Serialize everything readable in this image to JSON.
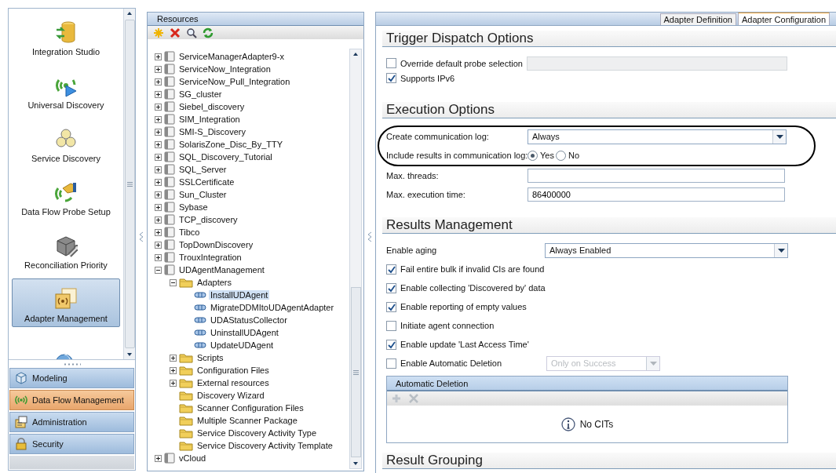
{
  "nav": {
    "items": [
      {
        "kind": "integration",
        "label": "Integration Studio",
        "selected": false
      },
      {
        "kind": "discovery",
        "label": "Universal Discovery",
        "selected": false
      },
      {
        "kind": "service",
        "label": "Service Discovery",
        "selected": false
      },
      {
        "kind": "probe",
        "label": "Data Flow Probe Setup",
        "selected": false
      },
      {
        "kind": "reconciliation",
        "label": "Reconciliation Priority",
        "selected": false
      },
      {
        "kind": "adapter",
        "label": "Adapter Management",
        "selected": true
      },
      {
        "kind": "globe",
        "selected": false
      }
    ],
    "modules": [
      {
        "kind": "modeling",
        "label": "Modeling",
        "selected": false
      },
      {
        "kind": "dataflow",
        "label": "Data Flow Management",
        "selected": true
      },
      {
        "kind": "admin",
        "label": "Administration",
        "selected": false
      },
      {
        "kind": "security",
        "label": "Security",
        "selected": false
      }
    ]
  },
  "resources": {
    "title": "Resources",
    "toolbar": [
      {
        "kind": "new"
      },
      {
        "kind": "delete"
      },
      {
        "kind": "find"
      },
      {
        "kind": "refresh"
      }
    ],
    "tree": [
      {
        "kind": "package",
        "label": "ServiceManagerAdapter9-x",
        "expanded": false,
        "selected": false
      },
      {
        "kind": "package",
        "label": "ServiceNow_Integration",
        "expanded": false,
        "selected": false
      },
      {
        "kind": "package",
        "label": "ServiceNow_Pull_Integration",
        "expanded": false,
        "selected": false
      },
      {
        "kind": "package",
        "label": "SG_cluster",
        "expanded": false,
        "selected": false
      },
      {
        "kind": "package",
        "label": "Siebel_discovery",
        "expanded": false,
        "selected": false
      },
      {
        "kind": "package",
        "label": "SIM_Integration",
        "expanded": false,
        "selected": false
      },
      {
        "kind": "package",
        "label": "SMI-S_Discovery",
        "expanded": false,
        "selected": false
      },
      {
        "kind": "package",
        "label": "SolarisZone_Disc_By_TTY",
        "expanded": false,
        "selected": false
      },
      {
        "kind": "package",
        "label": "SQL_Discovery_Tutorial",
        "expanded": false,
        "selected": false
      },
      {
        "kind": "package",
        "label": "SQL_Server",
        "expanded": false,
        "selected": false
      },
      {
        "kind": "package",
        "label": "SSLCertificate",
        "expanded": false,
        "selected": false
      },
      {
        "kind": "package",
        "label": "Sun_Cluster",
        "expanded": false,
        "selected": false
      },
      {
        "kind": "package",
        "label": "Sybase",
        "expanded": false,
        "selected": false
      },
      {
        "kind": "package",
        "label": "TCP_discovery",
        "expanded": false,
        "selected": false
      },
      {
        "kind": "package",
        "label": "Tibco",
        "expanded": false,
        "selected": false
      },
      {
        "kind": "package",
        "label": "TopDownDiscovery",
        "expanded": false,
        "selected": false
      },
      {
        "kind": "package",
        "label": "TrouxIntegration",
        "expanded": false,
        "selected": false
      },
      {
        "kind": "package",
        "label": "UDAgentManagement",
        "expanded": true,
        "selected": false,
        "children": [
          {
            "kind": "folder",
            "label": "Adapters",
            "expanded": true,
            "selected": false,
            "children": [
              {
                "kind": "adapter",
                "label": "InstallUDAgent",
                "selected": true
              },
              {
                "kind": "adapter",
                "label": "MigrateDDMItoUDAgentAdapter",
                "selected": false
              },
              {
                "kind": "adapter",
                "label": "UDAStatusCollector",
                "selected": false
              },
              {
                "kind": "adapter",
                "label": "UninstallUDAgent",
                "selected": false
              },
              {
                "kind": "adapter",
                "label": "UpdateUDAgent",
                "selected": false
              }
            ]
          },
          {
            "kind": "folder",
            "label": "Scripts",
            "expanded": false,
            "selected": false
          },
          {
            "kind": "folder",
            "label": "Configuration Files",
            "expanded": false,
            "selected": false
          },
          {
            "kind": "folder",
            "label": "External resources",
            "expanded": false,
            "selected": false
          },
          {
            "kind": "folder",
            "label": "Discovery Wizard",
            "selected": false
          },
          {
            "kind": "folder",
            "label": "Scanner Configuration Files",
            "selected": false
          },
          {
            "kind": "folder",
            "label": "Multiple Scanner Package",
            "selected": false
          },
          {
            "kind": "folder",
            "label": "Service Discovery Activity Type",
            "selected": false
          },
          {
            "kind": "folder",
            "label": "Service Discovery Activity Template",
            "selected": false
          }
        ]
      },
      {
        "kind": "package",
        "label": "vCloud",
        "expanded": false,
        "selected": false
      }
    ]
  },
  "config": {
    "tabs": [
      {
        "label": "Adapter Definition",
        "selected": false
      },
      {
        "label": "Adapter Configuration",
        "selected": true
      }
    ],
    "sections": [
      {
        "title": "Trigger Dispatch Options",
        "rows": [
          {
            "kind": "checkbox-field",
            "label": "Override default probe selection",
            "checked": false,
            "disabled": true
          },
          {
            "kind": "checkbox",
            "label": "Supports IPv6",
            "checked": true
          }
        ]
      },
      {
        "title": "Execution Options",
        "rows": [
          {
            "kind": "dropdown",
            "label": "Create communication log:",
            "value": "Always",
            "circled": true
          },
          {
            "kind": "radio",
            "label": "Include results in communication log:",
            "circled": true,
            "options": [
              {
                "label": "Yes",
                "selected": true
              },
              {
                "label": "No",
                "selected": false
              }
            ]
          },
          {
            "kind": "text",
            "label": "Max. threads:",
            "circled": false
          },
          {
            "kind": "text",
            "label": "Max. execution time:",
            "value": "86400000",
            "circled": false
          }
        ]
      },
      {
        "title": "Results Management",
        "rows": [
          {
            "kind": "dropdown",
            "label": "Enable aging",
            "value": "Always Enabled"
          },
          {
            "kind": "checkbox",
            "label": "Fail entire bulk if invalid CIs are found",
            "checked": true
          },
          {
            "kind": "checkbox",
            "label": "Enable collecting 'Discovered by' data",
            "checked": true
          },
          {
            "kind": "checkbox",
            "label": "Enable reporting of empty values",
            "checked": true
          },
          {
            "kind": "checkbox",
            "label": "Initiate agent connection",
            "checked": false
          },
          {
            "kind": "checkbox",
            "label": "Enable update 'Last Access Time'",
            "checked": true
          },
          {
            "kind": "checkbox-dropdown",
            "label": "Enable Automatic Deletion",
            "checked": false,
            "value": "Only on Success",
            "disabled": true
          },
          {
            "kind": "table",
            "title": "Automatic Deletion",
            "toolbar": [
              {
                "kind": "add",
                "disabled": true
              },
              {
                "kind": "delete",
                "disabled": true
              }
            ],
            "empty": "No CITs"
          }
        ]
      },
      {
        "title": "Result Grouping"
      }
    ]
  }
}
